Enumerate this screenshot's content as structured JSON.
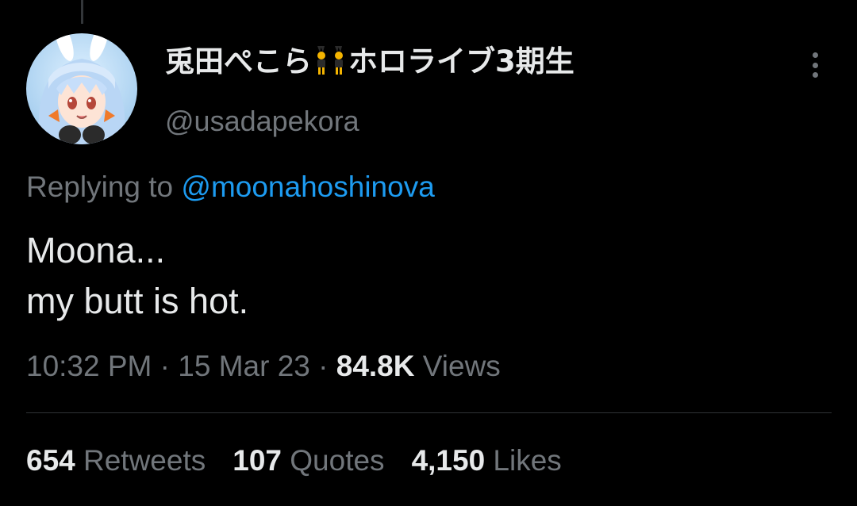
{
  "tweet": {
    "author": {
      "display_name_part1": "兎田ぺこら",
      "display_name_part2": "ホロライブ3期生",
      "name_emoji": "people-with-bunny-ears-emoji",
      "handle": "@usadapekora",
      "avatar": "avatar-image"
    },
    "more_icon": "more-vertical-icon",
    "replying_prefix": "Replying to ",
    "replying_to": "@moonahoshinova",
    "text_line1": "Moona...",
    "text_line2": "my butt is hot.",
    "time": "10:32 PM",
    "separator": " · ",
    "date": "15 Mar 23",
    "views_count": "84.8K",
    "views_label": " Views",
    "stats": {
      "retweets_count": "654",
      "retweets_label": " Retweets",
      "quotes_count": "107",
      "quotes_label": " Quotes",
      "likes_count": "4,150",
      "likes_label": " Likes"
    }
  },
  "colors": {
    "background": "#000000",
    "primary_text": "#e7e9ea",
    "secondary_text": "#71767b",
    "link": "#1d9bf0",
    "divider": "#2f3336"
  }
}
